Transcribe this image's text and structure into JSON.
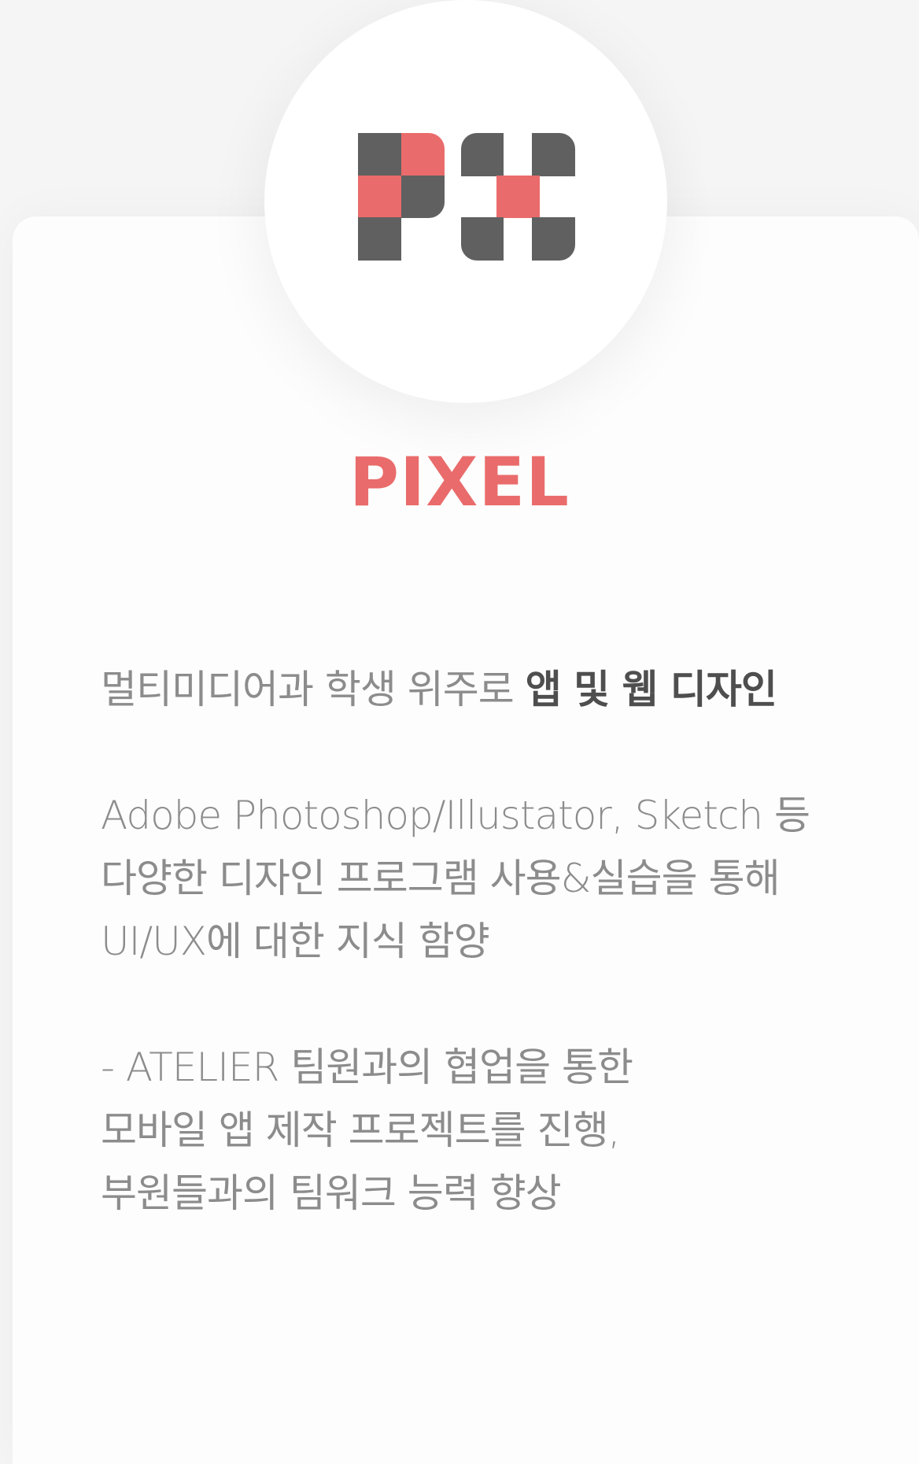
{
  "logo": {
    "name": "pixel-logo",
    "colors": {
      "dark": "#606060",
      "accent": "#ea6b6b"
    }
  },
  "club": {
    "title": "PIXEL"
  },
  "description": {
    "line1_prefix": "멀티미디어과 학생 위주로 ",
    "line1_bold": "앱 및 웹 디자인",
    "line2": "Adobe Photoshop/Illustator, Sketch 등",
    "line3": "다양한 디자인 프로그램 사용&실습을 통해",
    "line4": "UI/UX에 대한 지식 함양",
    "line5": "- ATELIER 팀원과의 협업을 통한",
    "line6": "모바일 앱 제작 프로젝트를 진행,",
    "line7": "부원들과의 팀워크 능력 향상"
  },
  "colors": {
    "background": "#f5f5f5",
    "card": "#fdfdfd",
    "accent": "#ea6b6b",
    "text": "#8c8c8c",
    "text_strong": "#4e4e4e"
  }
}
